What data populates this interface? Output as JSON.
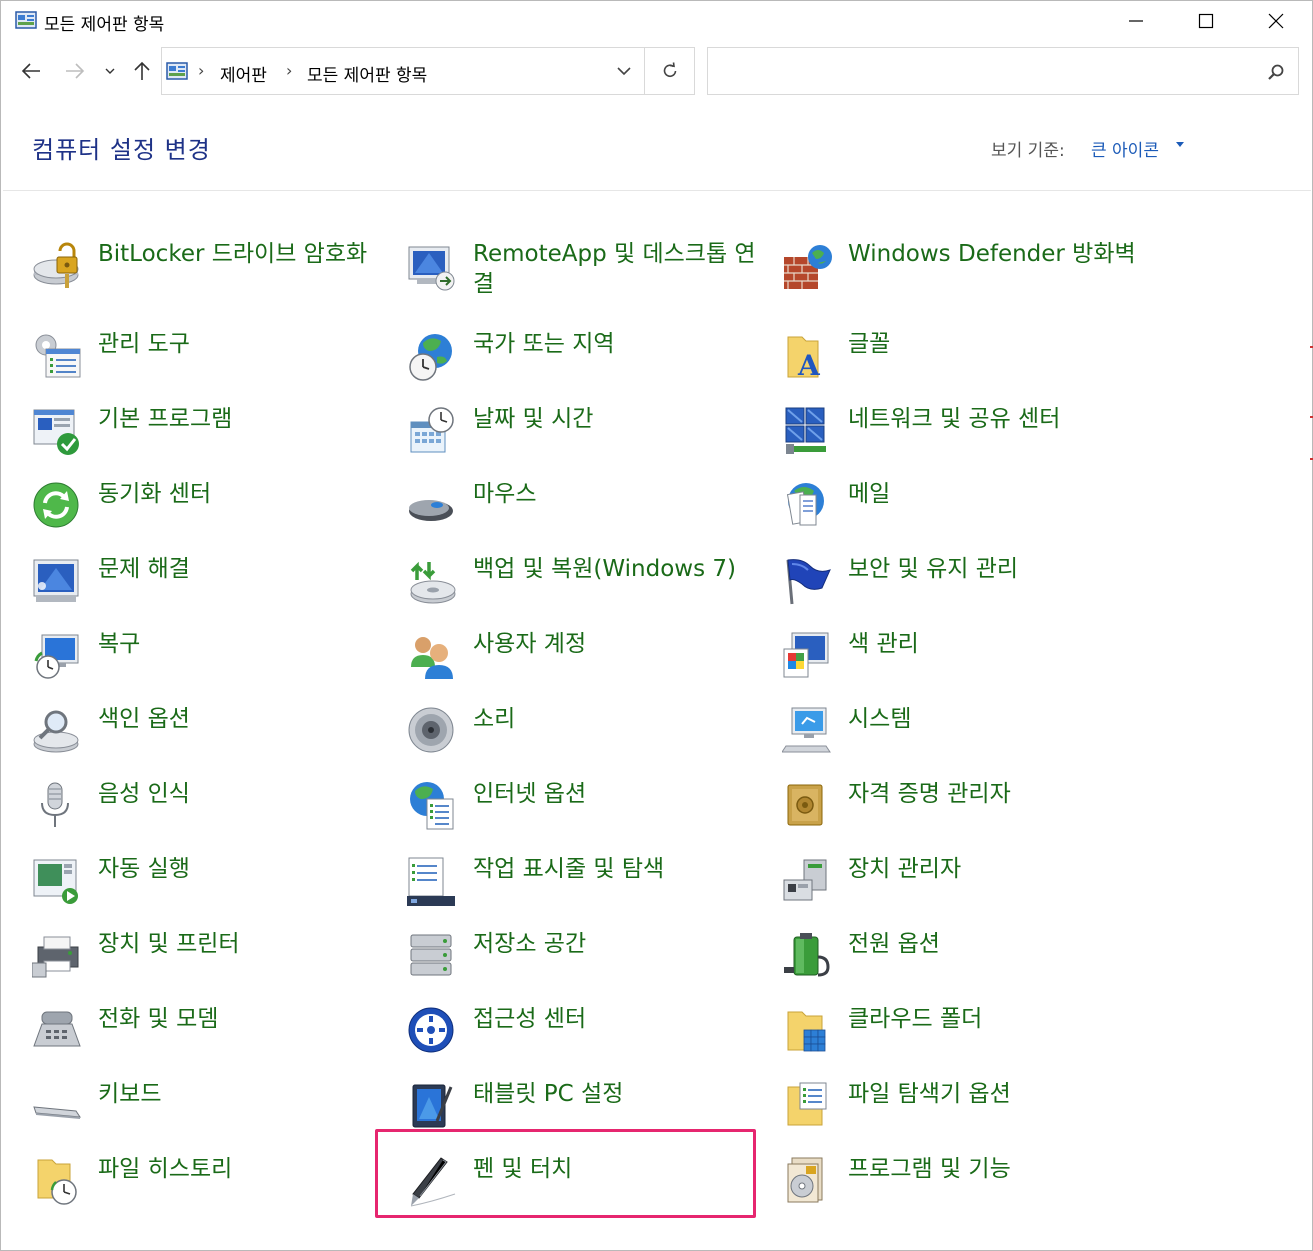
{
  "window": {
    "title": "모든 제어판 항목"
  },
  "address_bar": {
    "breadcrumbs": [
      "제어판",
      "모든 제어판 항목"
    ],
    "search_placeholder": ""
  },
  "header": {
    "title": "컴퓨터 설정 변경",
    "view_label": "보기 기준:",
    "view_value": "큰 아이콘"
  },
  "colors": {
    "item_text": "#1a6a18",
    "title_text": "#1e3287",
    "link_blue": "#1c5bb8",
    "highlight": "#e6266f"
  },
  "items": [
    {
      "label": "BitLocker 드라이브 암호화",
      "icon": "bitlocker-icon"
    },
    {
      "label": "RemoteApp 및 데스크톱 연결",
      "icon": "remoteapp-icon"
    },
    {
      "label": "Windows Defender 방화벽",
      "icon": "firewall-icon"
    },
    {
      "label": "관리 도구",
      "icon": "admin-tools-icon"
    },
    {
      "label": "국가 또는 지역",
      "icon": "region-icon"
    },
    {
      "label": "글꼴",
      "icon": "fonts-icon"
    },
    {
      "label": "기본 프로그램",
      "icon": "default-programs-icon"
    },
    {
      "label": "날짜 및 시간",
      "icon": "date-time-icon"
    },
    {
      "label": "네트워크 및 공유 센터",
      "icon": "network-icon"
    },
    {
      "label": "동기화 센터",
      "icon": "sync-center-icon"
    },
    {
      "label": "마우스",
      "icon": "mouse-icon"
    },
    {
      "label": "메일",
      "icon": "mail-icon"
    },
    {
      "label": "문제 해결",
      "icon": "troubleshooting-icon"
    },
    {
      "label": "백업 및 복원(Windows 7)",
      "icon": "backup-icon"
    },
    {
      "label": "보안 및 유지 관리",
      "icon": "security-flag-icon"
    },
    {
      "label": "복구",
      "icon": "recovery-icon"
    },
    {
      "label": "사용자 계정",
      "icon": "user-accounts-icon"
    },
    {
      "label": "색 관리",
      "icon": "color-management-icon"
    },
    {
      "label": "색인 옵션",
      "icon": "indexing-icon"
    },
    {
      "label": "소리",
      "icon": "sound-icon"
    },
    {
      "label": "시스템",
      "icon": "system-icon"
    },
    {
      "label": "음성 인식",
      "icon": "microphone-icon"
    },
    {
      "label": "인터넷 옵션",
      "icon": "internet-options-icon"
    },
    {
      "label": "자격 증명 관리자",
      "icon": "credential-manager-icon"
    },
    {
      "label": "자동 실행",
      "icon": "autoplay-icon"
    },
    {
      "label": "작업 표시줄 및 탐색",
      "icon": "taskbar-icon"
    },
    {
      "label": "장치 관리자",
      "icon": "device-manager-icon"
    },
    {
      "label": "장치 및 프린터",
      "icon": "printer-icon"
    },
    {
      "label": "저장소 공간",
      "icon": "storage-spaces-icon"
    },
    {
      "label": "전원 옵션",
      "icon": "power-options-icon"
    },
    {
      "label": "전화 및 모뎀",
      "icon": "phone-modem-icon"
    },
    {
      "label": "접근성 센터",
      "icon": "ease-of-access-icon"
    },
    {
      "label": "클라우드 폴더",
      "icon": "cloud-folder-icon"
    },
    {
      "label": "키보드",
      "icon": "keyboard-icon"
    },
    {
      "label": "태블릿 PC 설정",
      "icon": "tablet-icon"
    },
    {
      "label": "파일 탐색기 옵션",
      "icon": "folder-options-icon"
    },
    {
      "label": "파일 히스토리",
      "icon": "file-history-icon"
    },
    {
      "label": "펜 및 터치",
      "icon": "pen-icon"
    },
    {
      "label": "프로그램 및 기능",
      "icon": "programs-features-icon"
    }
  ]
}
